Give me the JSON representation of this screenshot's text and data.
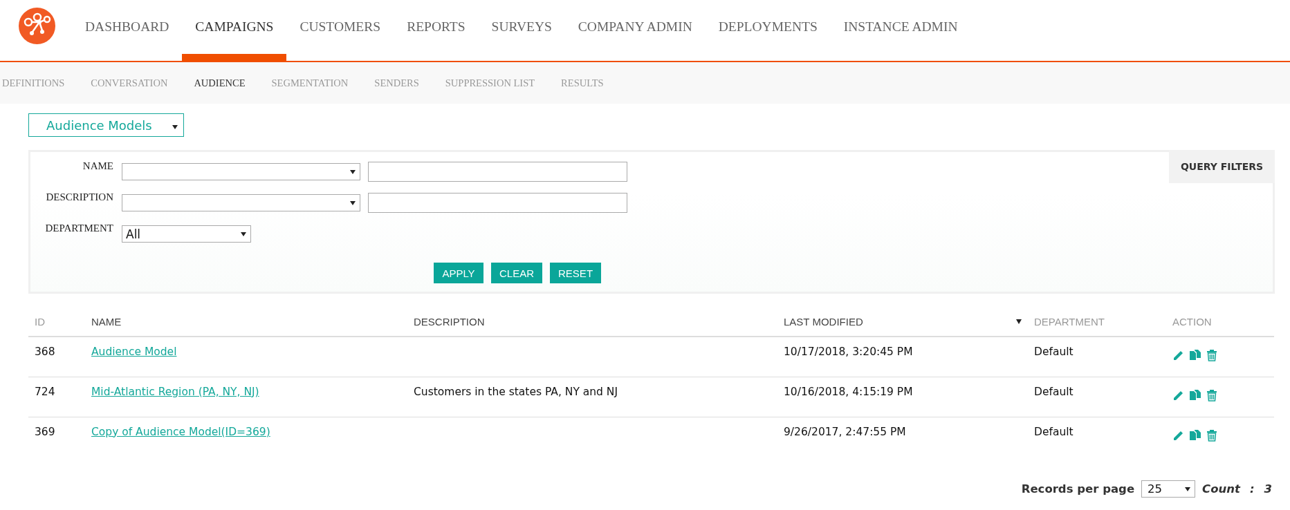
{
  "nav": {
    "items": [
      {
        "label": "DASHBOARD",
        "selected": false
      },
      {
        "label": "CAMPAIGNS",
        "selected": true
      },
      {
        "label": "CUSTOMERS",
        "selected": false
      },
      {
        "label": "REPORTS",
        "selected": false
      },
      {
        "label": "SURVEYS",
        "selected": false
      },
      {
        "label": "COMPANY ADMIN",
        "selected": false
      },
      {
        "label": "DEPLOYMENTS",
        "selected": false
      },
      {
        "label": "INSTANCE ADMIN",
        "selected": false
      }
    ]
  },
  "subnav": {
    "items": [
      {
        "label": "DEFINITIONS",
        "selected": false
      },
      {
        "label": "CONVERSATION",
        "selected": false
      },
      {
        "label": "AUDIENCE",
        "selected": true
      },
      {
        "label": "SEGMENTATION",
        "selected": false
      },
      {
        "label": "SENDERS",
        "selected": false
      },
      {
        "label": "SUPPRESSION LIST",
        "selected": false
      },
      {
        "label": "RESULTS",
        "selected": false
      }
    ]
  },
  "view_selector": {
    "value": "Audience Models"
  },
  "filters": {
    "tab": "QUERY FILTERS",
    "rows": [
      {
        "label": "NAME",
        "kind": "text",
        "select": "",
        "value": ""
      },
      {
        "label": "DESCRIPTION",
        "kind": "text",
        "select": "",
        "value": ""
      },
      {
        "label": "DEPARTMENT",
        "kind": "select",
        "select": "All"
      }
    ],
    "buttons": [
      "APPLY",
      "CLEAR",
      "RESET"
    ]
  },
  "table": {
    "columns": [
      {
        "label": "ID",
        "dimmed": true,
        "sorted": false
      },
      {
        "label": "NAME",
        "dimmed": false,
        "sorted": false
      },
      {
        "label": "DESCRIPTION",
        "dimmed": false,
        "sorted": false
      },
      {
        "label": "LAST MODIFIED",
        "dimmed": false,
        "sorted": true
      },
      {
        "label": "DEPARTMENT",
        "dimmed": true,
        "sorted": false
      },
      {
        "label": "ACTION",
        "dimmed": true,
        "sorted": false
      }
    ],
    "rows": [
      {
        "id": "368",
        "name": "Audience Model",
        "description": "",
        "last_modified": "10/17/2018, 3:20:45 PM",
        "department": "Default"
      },
      {
        "id": "724",
        "name": "Mid-Atlantic Region (PA, NY, NJ)",
        "description": "Customers in the states PA, NY and NJ",
        "last_modified": "10/16/2018, 4:15:19 PM",
        "department": "Default"
      },
      {
        "id": "369",
        "name": "Copy of Audience Model(ID=369)",
        "description": "",
        "last_modified": "9/26/2017, 2:47:55 PM",
        "department": "Default"
      }
    ]
  },
  "pager": {
    "label": "Records per page",
    "per_page": "25",
    "count_label": "Count",
    "count_separator": ":",
    "count": "3"
  }
}
